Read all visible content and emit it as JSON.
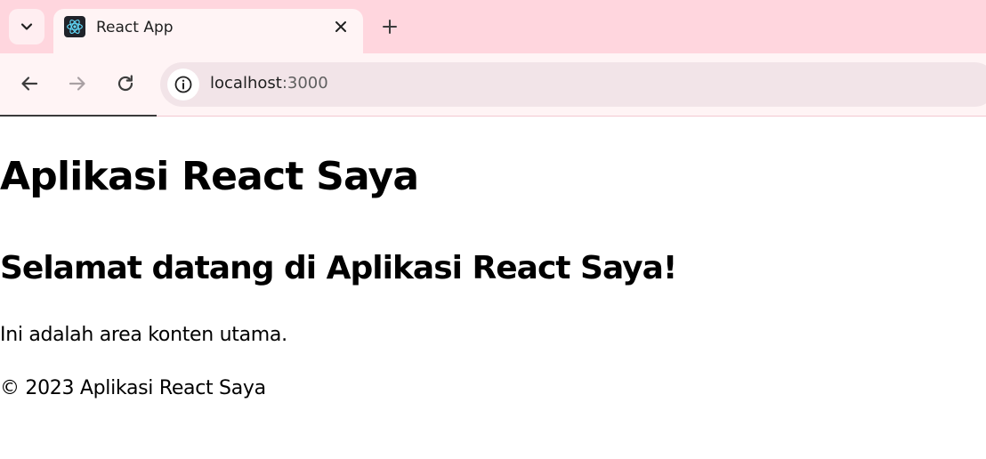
{
  "browser": {
    "tab": {
      "title": "React App",
      "favicon": "react-logo-icon"
    },
    "tab_search_icon": "chevron-down-icon",
    "close_icon": "close-icon",
    "new_tab_icon": "plus-icon",
    "nav": {
      "back_icon": "back-arrow-icon",
      "forward_icon": "forward-arrow-icon",
      "reload_icon": "reload-icon",
      "site_info_icon": "info-icon"
    },
    "address": {
      "host": "localhost",
      "port": ":3000"
    },
    "colors": {
      "tabstrip": "#ffd6de",
      "toolbar": "#fff4f5",
      "omnibox": "#f2e4e8"
    }
  },
  "page": {
    "title": "Aplikasi React Saya",
    "heading": "Selamat datang di Aplikasi React Saya!",
    "content": "Ini adalah area konten utama.",
    "footer": "© 2023 Aplikasi React Saya"
  }
}
